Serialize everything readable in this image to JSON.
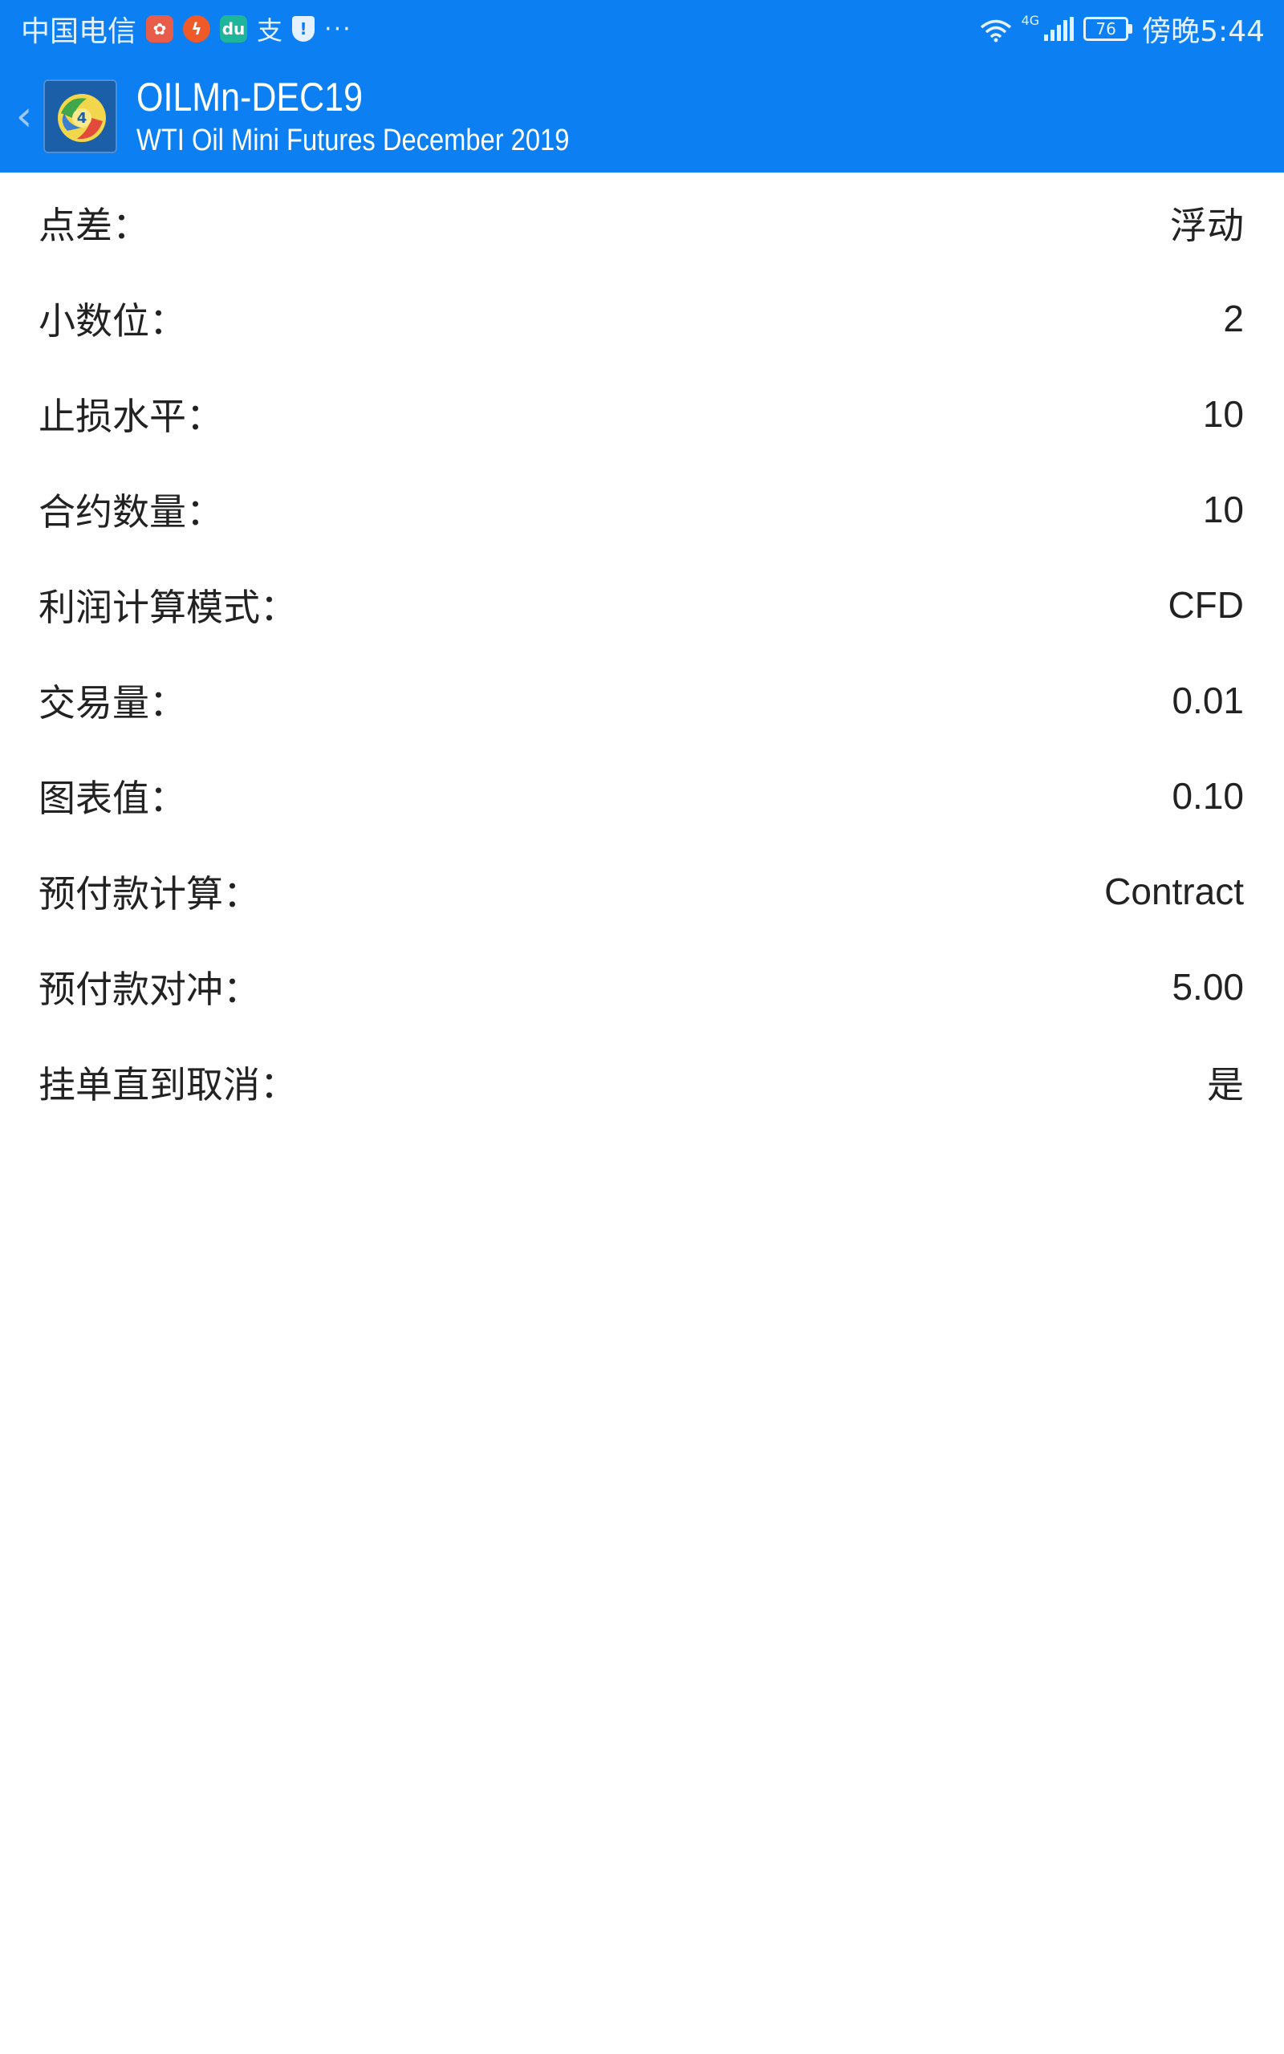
{
  "status_bar": {
    "carrier": "中国电信",
    "app_icons": [
      "weibo-icon",
      "flash-icon",
      "du-icon",
      "alipay-icon",
      "shield-icon"
    ],
    "du_label": "du",
    "alipay_label": "支",
    "more": "···",
    "network": "4G",
    "battery": "76",
    "time": "傍晚5:44"
  },
  "toolbar": {
    "title": "OILMn-DEC19",
    "subtitle": "WTI Oil Mini Futures December 2019"
  },
  "details": [
    {
      "label": "点差：",
      "value": "浮动"
    },
    {
      "label": "小数位：",
      "value": "2"
    },
    {
      "label": "止损水平：",
      "value": "10"
    },
    {
      "label": "合约数量：",
      "value": "10"
    },
    {
      "label": "利润计算模式：",
      "value": "CFD"
    },
    {
      "label": "交易量：",
      "value": "0.01"
    },
    {
      "label": "图表值：",
      "value": "0.10"
    },
    {
      "label": "预付款计算：",
      "value": "Contract"
    },
    {
      "label": "预付款对冲：",
      "value": "5.00"
    },
    {
      "label": "挂单直到取消：",
      "value": "是"
    }
  ],
  "colors": {
    "header": "#0c7ff2",
    "text": "#222222",
    "background": "#ffffff"
  }
}
